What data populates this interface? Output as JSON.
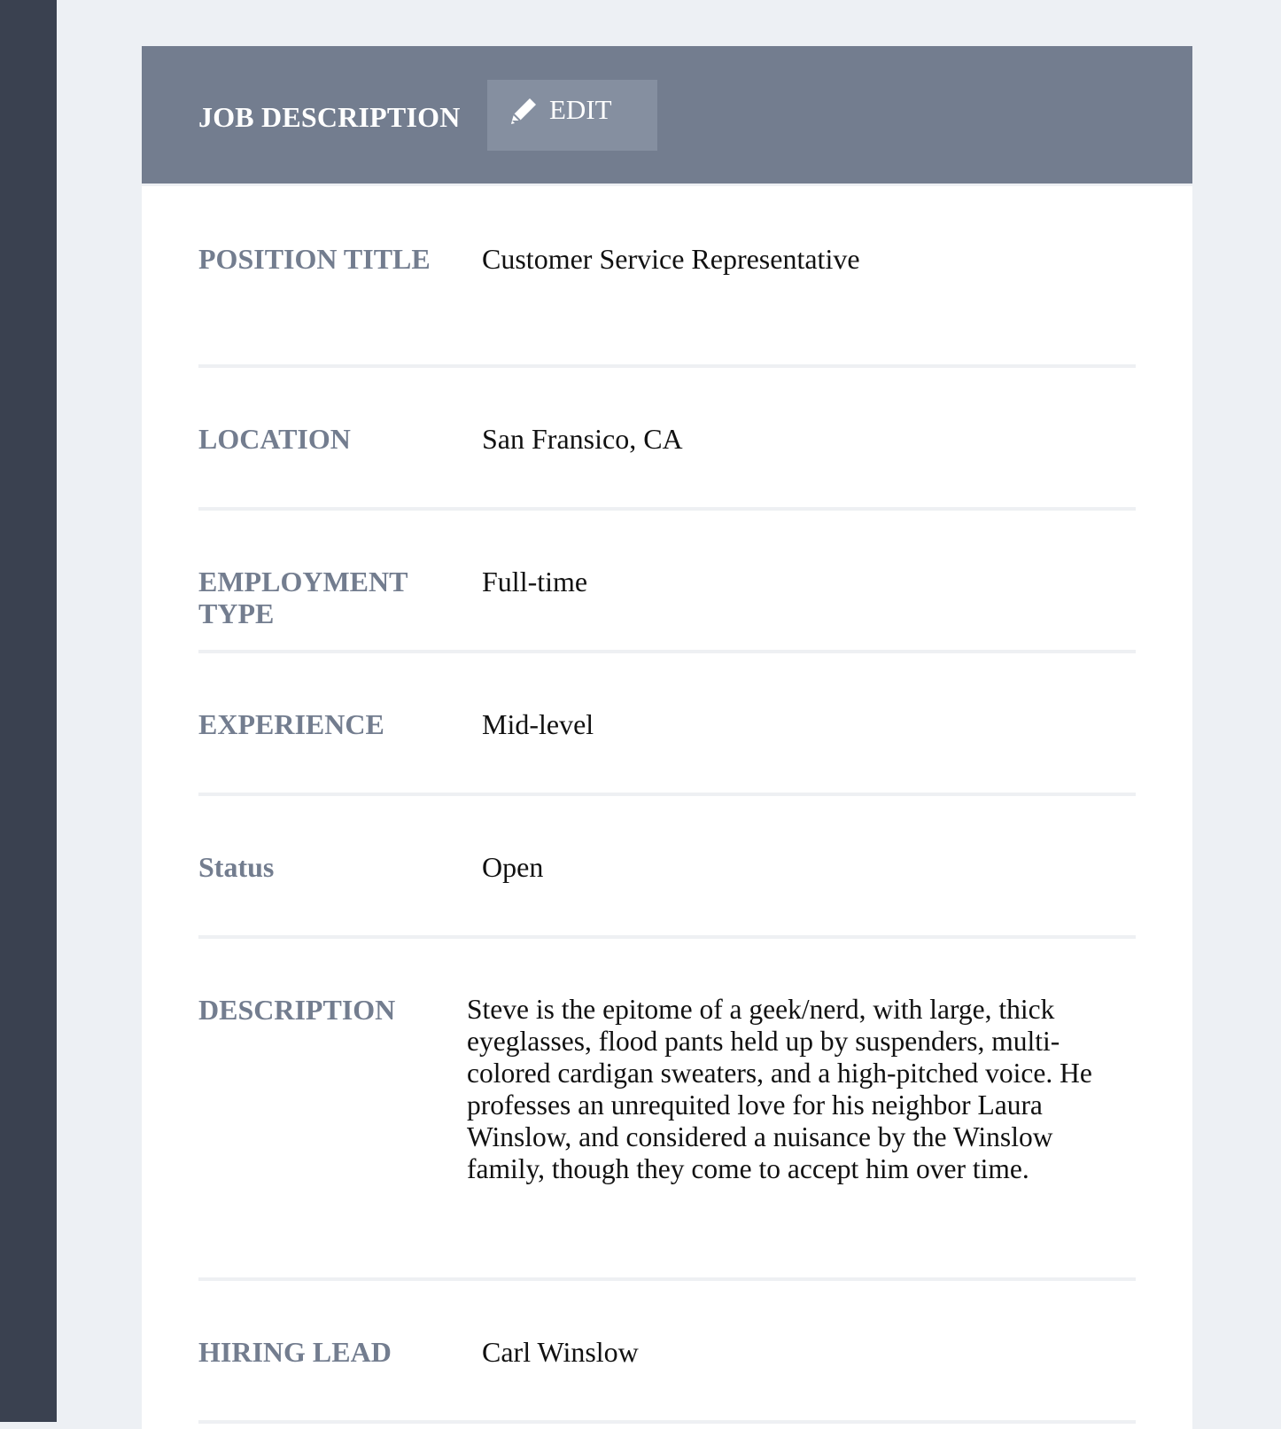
{
  "header": {
    "title": "JOB DESCRIPTION",
    "edit_label": "EDIT",
    "edit_icon": "pencil-icon"
  },
  "fields": [
    {
      "label": "POSITION TITLE",
      "value": "Customer Service Representative"
    },
    {
      "label": "LOCATION",
      "value": "San Fransico, CA"
    },
    {
      "label": "EMPLOYMENT TYPE",
      "value": "Full-time"
    },
    {
      "label": "EXPERIENCE",
      "value": "Mid-level"
    },
    {
      "label": "Status",
      "value": "Open"
    },
    {
      "label": "DESCRIPTION",
      "value": "Steve is the epitome of a geek/nerd, with large, thick eyeglasses, flood pants held up by suspenders, multi-colored cardigan sweaters, and a high-pitched voice. He professes an unrequited love for his neighbor Laura Winslow, and considered a nuisance by the Winslow family, though they come to accept him over time."
    },
    {
      "label": "HIRING LEAD",
      "value": "Carl Winslow"
    }
  ],
  "colors": {
    "sidebar": "#3a4150",
    "background": "#edf0f4",
    "header": "#737d8f",
    "edit_button": "#858fa0",
    "label": "#737d8f",
    "divider": "#eef0f3"
  }
}
